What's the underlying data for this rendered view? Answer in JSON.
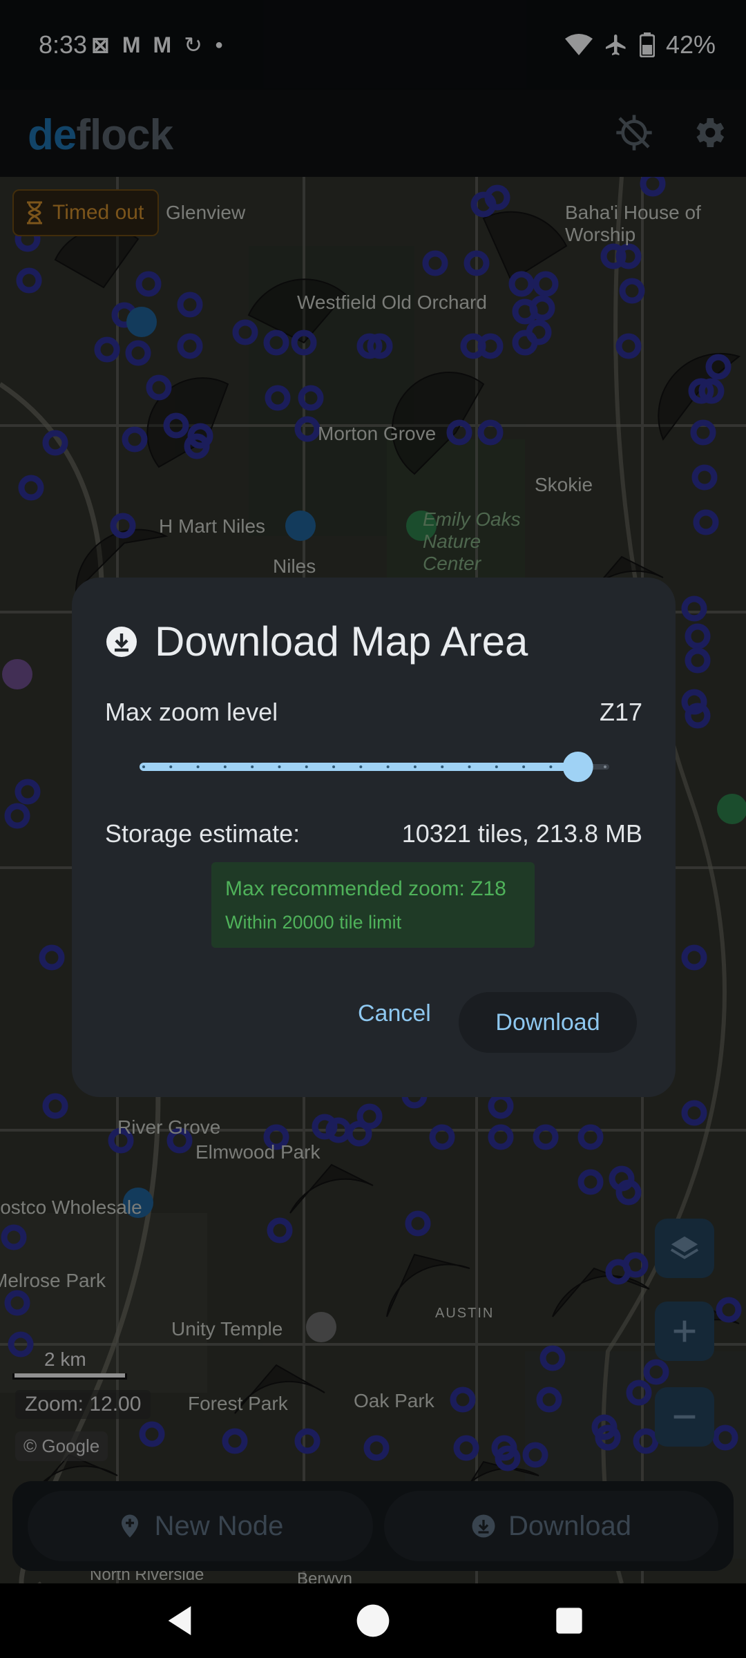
{
  "status_bar": {
    "time": "8:33",
    "battery": "42%",
    "icons": [
      "outlook-icon",
      "gmail-icon",
      "gmail-icon",
      "sync-icon",
      "dot-icon",
      "wifi-icon",
      "airplane-icon",
      "battery-icon"
    ]
  },
  "app": {
    "logo_de": "de",
    "logo_flock": "flock",
    "timed_out": "Timed out"
  },
  "map": {
    "labels": [
      {
        "text": "Glenview"
      },
      {
        "text": "Westfield Old Orchard"
      },
      {
        "text": "Baha'i House of Worship"
      },
      {
        "text": "Morton Grove"
      },
      {
        "text": "Skokie"
      },
      {
        "text": "H Mart Niles"
      },
      {
        "text": "Emily Oaks Nature Center"
      },
      {
        "text": "Niles"
      },
      {
        "text": "River Grove"
      },
      {
        "text": "Elmwood Park"
      },
      {
        "text": "Costco Wholesale"
      },
      {
        "text": "Melrose Park"
      },
      {
        "text": "Unity Temple"
      },
      {
        "text": "AUSTIN"
      },
      {
        "text": "Forest Park"
      },
      {
        "text": "Oak Park"
      },
      {
        "text": "North Riverside"
      },
      {
        "text": "Berwyn"
      }
    ],
    "scale_label": "2 km",
    "zoom_readout": "Zoom: 12.00",
    "attribution": "© Google"
  },
  "dialog": {
    "title": "Download Map Area",
    "zoom_label": "Max zoom level",
    "zoom_value": "Z17",
    "slider": {
      "min": 1,
      "max": 18,
      "value": 17
    },
    "storage_label": "Storage estimate:",
    "storage_value": "10321 tiles, 213.8 MB",
    "recommend_main": "Max recommended zoom: Z18",
    "recommend_sub": "Within 20000 tile limit",
    "cancel_label": "Cancel",
    "download_label": "Download"
  },
  "bottom_bar": {
    "new_node_label": "New Node",
    "download_label": "Download"
  },
  "colors": {
    "accent": "#8ec7ef",
    "node_ring": "#2a2f8a",
    "recommend_text": "#4fb25a",
    "timed_out": "#c98a2c"
  }
}
